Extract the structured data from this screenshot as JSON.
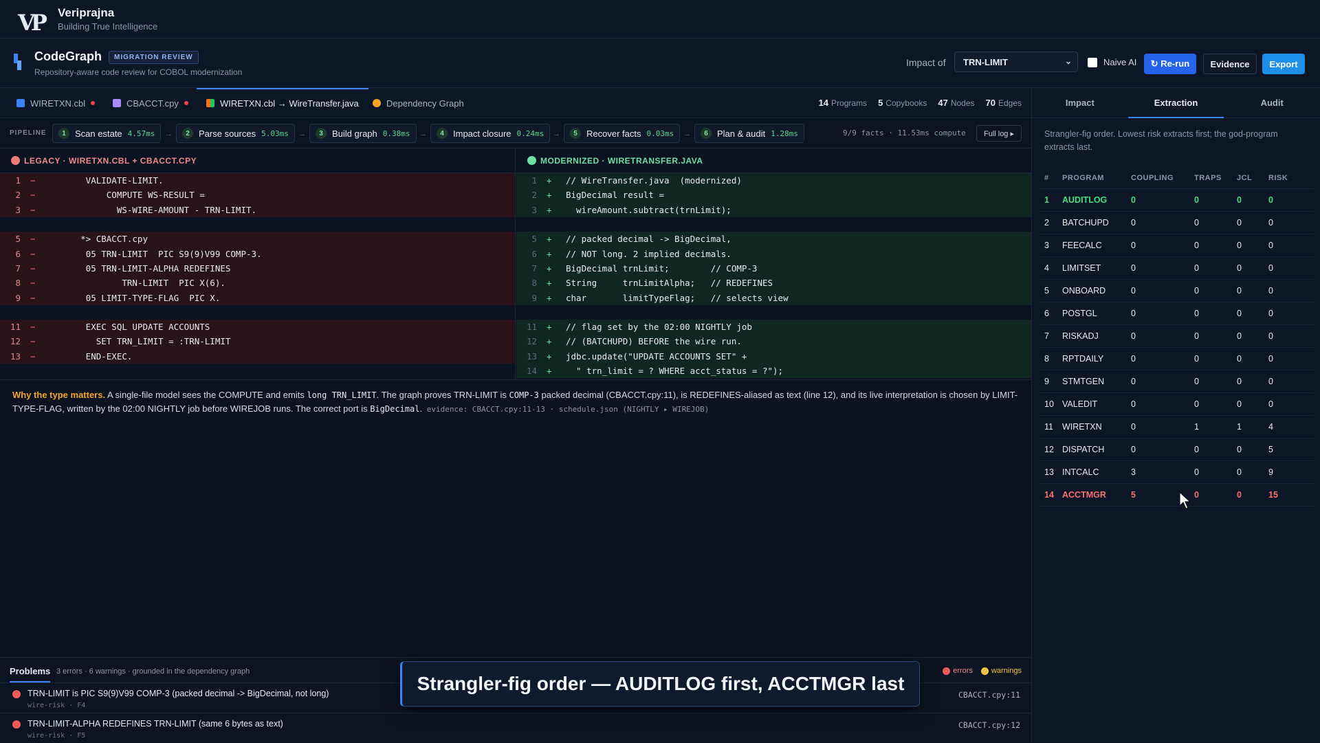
{
  "brand": {
    "name": "Veriprajna",
    "tagline": "Building True Intelligence",
    "logo_text": "VP"
  },
  "app": {
    "title": "CodeGraph",
    "badge": "MIGRATION REVIEW",
    "subtitle": "Repository-aware code review for COBOL modernization",
    "impact_label": "Impact of",
    "impact_value": "TRN-LIMIT",
    "naive_label": "Naive AI",
    "rerun_label": "↻ Re-run",
    "evidence_label": "Evidence",
    "export_label": "Export"
  },
  "tabs": [
    {
      "label": "WIRETXN.cbl",
      "color": "#3b82f6",
      "dirty": true
    },
    {
      "label": "CBACCT.cpy",
      "color": "#a78bfa",
      "dirty": true
    },
    {
      "label": "WIRETXN.cbl → WireTransfer.java",
      "color": "#f97316",
      "dirty": false,
      "active": true
    },
    {
      "label": "Dependency Graph",
      "color": "#f5a524",
      "dirty": false
    }
  ],
  "counts": [
    {
      "value": "14",
      "label": "Programs"
    },
    {
      "value": "5",
      "label": "Copybooks"
    },
    {
      "value": "47",
      "label": "Nodes"
    },
    {
      "value": "70",
      "label": "Edges"
    }
  ],
  "pipeline": {
    "label": "PIPELINE",
    "steps": [
      {
        "num": "1",
        "name": "Scan estate",
        "time": "4.57ms"
      },
      {
        "num": "2",
        "name": "Parse sources",
        "time": "5.03ms"
      },
      {
        "num": "3",
        "name": "Build graph",
        "time": "0.38ms"
      },
      {
        "num": "4",
        "name": "Impact closure",
        "time": "0.24ms"
      },
      {
        "num": "5",
        "name": "Recover facts",
        "time": "0.03ms"
      },
      {
        "num": "6",
        "name": "Plan & audit",
        "time": "1.28ms"
      }
    ],
    "summary": "9/9 facts · 11.53ms compute",
    "fulllog_label": "Full log ▸"
  },
  "legacy": {
    "title": "LEGACY · WIRETXN.CBL + CBACCT.CPY",
    "lines": [
      {
        "n": "1",
        "sign": "−",
        "text": "       VALIDATE-LIMIT."
      },
      {
        "n": "2",
        "sign": "−",
        "text": "           COMPUTE WS-RESULT ="
      },
      {
        "n": "3",
        "sign": "−",
        "text": "             WS-WIRE-AMOUNT - TRN-LIMIT."
      },
      {
        "gap": true
      },
      {
        "n": "5",
        "sign": "−",
        "text": "      *> CBACCT.cpy"
      },
      {
        "n": "6",
        "sign": "−",
        "text": "       05 TRN-LIMIT  PIC S9(9)V99 COMP-3."
      },
      {
        "n": "7",
        "sign": "−",
        "text": "       05 TRN-LIMIT-ALPHA REDEFINES"
      },
      {
        "n": "8",
        "sign": "−",
        "text": "              TRN-LIMIT  PIC X(6)."
      },
      {
        "n": "9",
        "sign": "−",
        "text": "       05 LIMIT-TYPE-FLAG  PIC X."
      },
      {
        "gap": true
      },
      {
        "n": "11",
        "sign": "−",
        "text": "       EXEC SQL UPDATE ACCOUNTS"
      },
      {
        "n": "12",
        "sign": "−",
        "text": "         SET TRN_LIMIT = :TRN-LIMIT"
      },
      {
        "n": "13",
        "sign": "−",
        "text": "       END-EXEC."
      }
    ]
  },
  "modern": {
    "title": "MODERNIZED · WIRETRANSFER.JAVA",
    "lines": [
      {
        "n": "1",
        "sign": "+",
        "text": "// WireTransfer.java  (modernized)"
      },
      {
        "n": "2",
        "sign": "+",
        "text": "BigDecimal result ="
      },
      {
        "n": "3",
        "sign": "+",
        "text": "  wireAmount.subtract(trnLimit);"
      },
      {
        "gap": true
      },
      {
        "n": "5",
        "sign": "+",
        "text": "// packed decimal -> BigDecimal,"
      },
      {
        "n": "6",
        "sign": "+",
        "text": "// NOT long. 2 implied decimals."
      },
      {
        "n": "7",
        "sign": "+",
        "text": "BigDecimal trnLimit;        // COMP-3"
      },
      {
        "n": "8",
        "sign": "+",
        "text": "String     trnLimitAlpha;   // REDEFINES"
      },
      {
        "n": "9",
        "sign": "+",
        "text": "char       limitTypeFlag;   // selects view"
      },
      {
        "gap": true
      },
      {
        "n": "11",
        "sign": "+",
        "text": "// flag set by the 02:00 NIGHTLY job"
      },
      {
        "n": "12",
        "sign": "+",
        "text": "// (BATCHUPD) BEFORE the wire run."
      },
      {
        "n": "13",
        "sign": "+",
        "text": "jdbc.update(\"UPDATE ACCOUNTS SET\" +"
      },
      {
        "n": "14",
        "sign": "+",
        "text": "  \" trn_limit = ? WHERE acct_status = ?\");"
      }
    ]
  },
  "explain": {
    "heading": "Why the type matters.",
    "p1": " A single-file model sees the COMPUTE and emits ",
    "c1": "long TRN_LIMIT",
    "p2": ". The graph proves TRN-LIMIT is ",
    "c2": "COMP-3",
    "p3": " packed decimal (CBACCT.cpy:11), is REDEFINES-aliased as text (line 12), and its live interpretation is chosen by LIMIT-TYPE-FLAG, written by the 02:00 NIGHTLY job before WIREJOB runs. The correct port is ",
    "c3": "BigDecimal",
    "p4": ".",
    "evidence": " evidence: CBACCT.cpy:11-13 · schedule.json (NIGHTLY ▸ WIREJOB)"
  },
  "problems": {
    "tab_label": "Problems",
    "summary": "3 errors · 6 warnings · grounded in the dependency graph",
    "legend_errors": "errors",
    "legend_warnings": "warnings",
    "items": [
      {
        "text": "TRN-LIMIT is PIC S9(9)V99 COMP-3 (packed decimal -> BigDecimal, not long)",
        "meta": "wire-risk · F4",
        "ref": "CBACCT.cpy:11"
      },
      {
        "text": "TRN-LIMIT-ALPHA REDEFINES TRN-LIMIT (same 6 bytes as text)",
        "meta": "wire-risk · F5",
        "ref": "CBACCT.cpy:12"
      }
    ]
  },
  "toast": "Strangler-fig order — AUDITLOG first, ACCTMGR last",
  "right": {
    "tabs": [
      "Impact",
      "Extraction",
      "Audit"
    ],
    "active_tab": 1,
    "description": "Strangler-fig order. Lowest risk extracts first; the god-program extracts last.",
    "columns": [
      "#",
      "PROGRAM",
      "COUPLING",
      "TRAPS",
      "JCL",
      "RISK"
    ],
    "rows": [
      [
        "1",
        "AUDITLOG",
        "0",
        "0",
        "0",
        "0"
      ],
      [
        "2",
        "BATCHUPD",
        "0",
        "0",
        "0",
        "0"
      ],
      [
        "3",
        "FEECALC",
        "0",
        "0",
        "0",
        "0"
      ],
      [
        "4",
        "LIMITSET",
        "0",
        "0",
        "0",
        "0"
      ],
      [
        "5",
        "ONBOARD",
        "0",
        "0",
        "0",
        "0"
      ],
      [
        "6",
        "POSTGL",
        "0",
        "0",
        "0",
        "0"
      ],
      [
        "7",
        "RISKADJ",
        "0",
        "0",
        "0",
        "0"
      ],
      [
        "8",
        "RPTDAILY",
        "0",
        "0",
        "0",
        "0"
      ],
      [
        "9",
        "STMTGEN",
        "0",
        "0",
        "0",
        "0"
      ],
      [
        "10",
        "VALEDIT",
        "0",
        "0",
        "0",
        "0"
      ],
      [
        "11",
        "WIRETXN",
        "0",
        "1",
        "1",
        "4"
      ],
      [
        "12",
        "DISPATCH",
        "0",
        "0",
        "0",
        "5"
      ],
      [
        "13",
        "INTCALC",
        "3",
        "0",
        "0",
        "9"
      ],
      [
        "14",
        "ACCTMGR",
        "5",
        "0",
        "0",
        "15"
      ]
    ]
  }
}
